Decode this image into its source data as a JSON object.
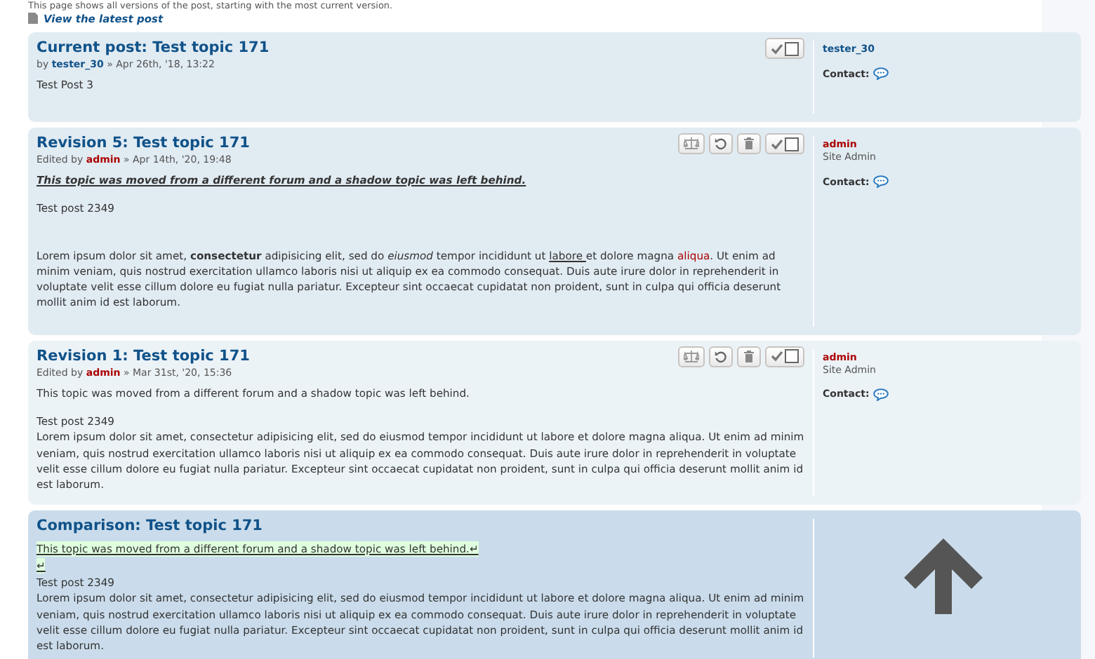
{
  "intro": "This page shows all versions of the post, starting with the most current version.",
  "latest_link": "View the latest post",
  "posts": [
    {
      "kind": "current",
      "title": "Current post: Test topic 171",
      "meta_prefix": "by",
      "author": {
        "name": "tester_30",
        "kind": "user"
      },
      "date": "» Apr 26th, '18, 13:22",
      "actions": [
        {
          "kind": "select",
          "checked": false
        }
      ],
      "body": [
        {
          "kind": "plain",
          "segments": [
            {
              "kind": "plain",
              "text": "Test Post 3"
            }
          ]
        }
      ],
      "profile": {
        "username": "tester_30",
        "kind": "user",
        "contact": "Contact:"
      }
    },
    {
      "kind": "revision",
      "title": "Revision 5: Test topic 171",
      "meta_prefix": "Edited by",
      "author": {
        "name": "admin",
        "kind": "admin"
      },
      "date": "» Apr 14th, '20, 19:48",
      "actions": [
        {
          "kind": "compare"
        },
        {
          "kind": "restore"
        },
        {
          "kind": "delete"
        },
        {
          "kind": "select",
          "checked": false
        }
      ],
      "body": [
        {
          "kind": "emphasis",
          "segments": [
            {
              "kind": "plain",
              "text": "This topic was moved from a different forum and a shadow topic was left behind."
            }
          ]
        },
        {
          "kind": "plain",
          "segments": [
            {
              "kind": "plain",
              "text": "Test post 2349"
            }
          ]
        },
        {
          "kind": "spaced",
          "segments": [
            {
              "kind": "plain",
              "text": "Lorem ipsum dolor sit amet, "
            },
            {
              "kind": "bold",
              "text": "consectetur"
            },
            {
              "kind": "plain",
              "text": " adipisicing elit, sed do "
            },
            {
              "kind": "italic",
              "text": "eiusmod"
            },
            {
              "kind": "plain",
              "text": " tempor incididunt ut "
            },
            {
              "kind": "underline",
              "text": "labore "
            },
            {
              "kind": "plain",
              "text": "et dolore magna "
            },
            {
              "kind": "red",
              "text": "aliqua"
            },
            {
              "kind": "plain",
              "text": ". Ut enim ad minim veniam, quis nostrud exercitation ullamco laboris nisi ut aliquip ex ea commodo consequat. Duis aute irure dolor in reprehenderit in voluptate velit esse cillum dolore eu fugiat nulla pariatur. Excepteur sint occaecat cupidatat non proident, sunt in culpa qui officia deserunt mollit anim id est laborum."
            }
          ]
        }
      ],
      "profile": {
        "username": "admin",
        "kind": "admin",
        "rank": "Site Admin",
        "contact": "Contact:"
      }
    },
    {
      "kind": "revision",
      "title": "Revision 1: Test topic 171",
      "meta_prefix": "Edited by",
      "author": {
        "name": "admin",
        "kind": "admin"
      },
      "date": "» Mar 31st, '20, 15:36",
      "actions": [
        {
          "kind": "compare"
        },
        {
          "kind": "restore"
        },
        {
          "kind": "delete"
        },
        {
          "kind": "select",
          "checked": false
        }
      ],
      "body": [
        {
          "kind": "plain",
          "segments": [
            {
              "kind": "plain",
              "text": "This topic was moved from a different forum and a shadow topic was left behind."
            }
          ]
        },
        {
          "kind": "tight",
          "segments": [
            {
              "kind": "plain",
              "text": "Test post 2349"
            }
          ]
        },
        {
          "kind": "joined",
          "segments": [
            {
              "kind": "plain",
              "text": "Lorem ipsum dolor sit amet, consectetur adipisicing elit, sed do eiusmod tempor incididunt ut labore et dolore magna aliqua. Ut enim ad minim veniam, quis nostrud exercitation ullamco laboris nisi ut aliquip ex ea commodo consequat. Duis aute irure dolor in reprehenderit in voluptate velit esse cillum dolore eu fugiat nulla pariatur. Excepteur sint occaecat cupidatat non proident, sunt in culpa qui officia deserunt mollit anim id est laborum."
            }
          ]
        }
      ],
      "profile": {
        "username": "admin",
        "kind": "admin",
        "rank": "Site Admin",
        "contact": "Contact:"
      }
    },
    {
      "kind": "comparison",
      "title": "Comparison: Test topic 171",
      "body": [
        {
          "kind": "inserted",
          "segments": [
            {
              "kind": "plain",
              "text": "This topic was moved from a different forum and a shadow topic was left behind.↵"
            }
          ]
        },
        {
          "kind": "inserted",
          "segments": [
            {
              "kind": "plain",
              "text": "↵"
            }
          ]
        },
        {
          "kind": "joined",
          "segments": [
            {
              "kind": "plain",
              "text": "Test post 2349"
            }
          ]
        },
        {
          "kind": "joined",
          "segments": [
            {
              "kind": "plain",
              "text": "Lorem ipsum dolor sit amet, consectetur adipisicing elit, sed do eiusmod tempor incididunt ut labore et dolore magna aliqua. Ut enim ad minim veniam, quis nostrud exercitation ullamco laboris nisi ut aliquip ex ea commodo consequat. Duis aute irure dolor in reprehenderit in voluptate velit esse cillum dolore eu fugiat nulla pariatur. Excepteur sint occaecat cupidatat non proident, sunt in culpa qui officia deserunt mollit anim id est laborum."
            }
          ]
        }
      ]
    }
  ]
}
